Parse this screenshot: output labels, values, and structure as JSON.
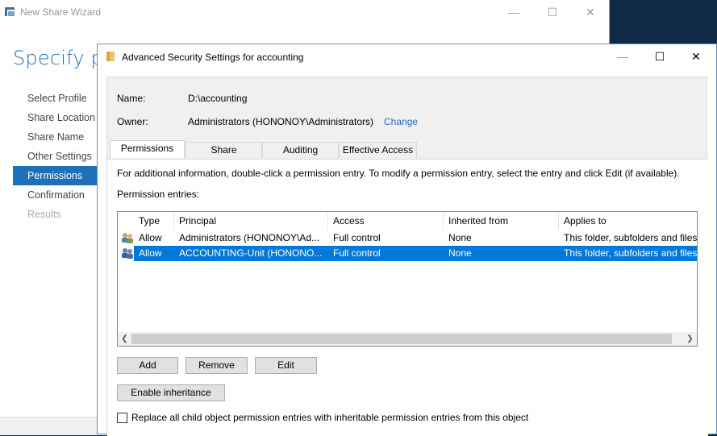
{
  "wizard": {
    "title": "New Share Wizard",
    "heading": "Specify pe",
    "nav": [
      {
        "label": "Select Profile",
        "state": "normal"
      },
      {
        "label": "Share Location",
        "state": "normal"
      },
      {
        "label": "Share Name",
        "state": "normal"
      },
      {
        "label": "Other Settings",
        "state": "normal"
      },
      {
        "label": "Permissions",
        "state": "active"
      },
      {
        "label": "Confirmation",
        "state": "normal"
      },
      {
        "label": "Results",
        "state": "disabled"
      }
    ],
    "controls": {
      "minimize": "—",
      "maximize": "☐",
      "close": "✕"
    }
  },
  "dialog": {
    "title": "Advanced Security Settings for accounting",
    "controls": {
      "minimize": "—",
      "maximize": "☐",
      "close": "✕"
    },
    "name_label": "Name:",
    "name_value": "D:\\accounting",
    "owner_label": "Owner:",
    "owner_value": "Administrators (HONONOY\\Administrators)",
    "change_link": "Change",
    "tabs": [
      "Permissions",
      "Share",
      "Auditing",
      "Effective Access"
    ],
    "info_text": "For additional information, double-click a permission entry. To modify a permission entry, select the entry and click Edit (if available).",
    "entries_label": "Permission entries:",
    "columns": [
      "Type",
      "Principal",
      "Access",
      "Inherited from",
      "Applies to"
    ],
    "rows": [
      {
        "type": "Allow",
        "principal": "Administrators (HONONOY\\Ad...",
        "access": "Full control",
        "inherited": "None",
        "applies": "This folder, subfolders and files",
        "selected": false
      },
      {
        "type": "Allow",
        "principal": "ACCOUNTING-Unit (HONONO...",
        "access": "Full control",
        "inherited": "None",
        "applies": "This folder, subfolders and files",
        "selected": true
      }
    ],
    "buttons": {
      "add": "Add",
      "remove": "Remove",
      "edit": "Edit",
      "enable_inheritance": "Enable inheritance"
    },
    "replace_checkbox": {
      "label": "Replace all child object permission entries with inheritable permission entries from this object",
      "checked": false
    }
  },
  "colors": {
    "accent": "#0078d7",
    "nav_active": "#1e70b8",
    "link": "#1e70b8"
  }
}
